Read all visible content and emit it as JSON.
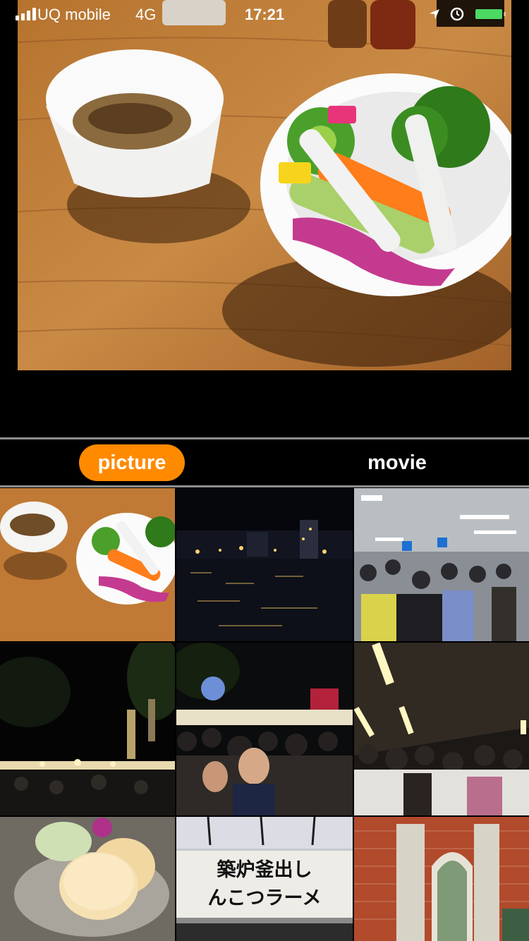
{
  "status_bar": {
    "carrier": "UQ mobile",
    "network": "4G",
    "time": "17:21",
    "battery_color": "#4cd964"
  },
  "tabs": [
    {
      "label": "picture",
      "selected": true
    },
    {
      "label": "movie",
      "selected": false
    }
  ],
  "accent_color": "#ff8a00",
  "thumbnails": [
    {
      "subject": "salad-and-soup"
    },
    {
      "subject": "night-river"
    },
    {
      "subject": "station-crowd"
    },
    {
      "subject": "night-festival-trees"
    },
    {
      "subject": "festival-crowd-balloons"
    },
    {
      "subject": "underpass-crowd"
    },
    {
      "subject": "pancakes"
    },
    {
      "subject": "ramen-shop-sign",
      "sign_line1": "築炉釜出し",
      "sign_line2": "んこつラーメ"
    },
    {
      "subject": "red-brick-building"
    }
  ]
}
